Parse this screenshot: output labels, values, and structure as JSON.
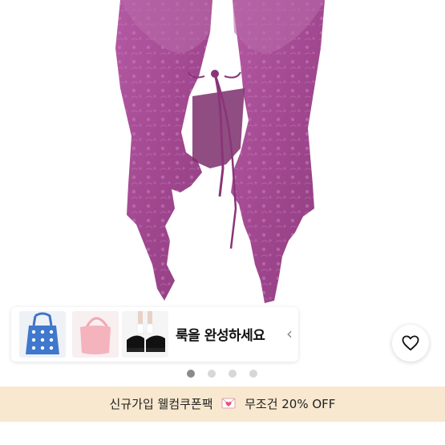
{
  "product": {
    "image_name": "pink-lace-ruffle-tie-top"
  },
  "complete_look": {
    "title": "룩을 완성하세요",
    "chevron": "‹",
    "thumbnails": [
      {
        "name": "blue-heart-knit-bag"
      },
      {
        "name": "pink-shoulder-bag"
      },
      {
        "name": "black-mary-jane-shoes"
      }
    ]
  },
  "like_button": {
    "icon": "heart-outline-icon"
  },
  "carousel": {
    "total": 4,
    "active": 0
  },
  "promo": {
    "text_before": "신규가입 웰컴쿠폰팩",
    "emoji": "heart-letter-icon",
    "text_after": "무조건 20% OFF"
  },
  "colors": {
    "fabric": "#a54a93",
    "promo_bg": "#f8e8cf",
    "dot_active": "#8a8a8a",
    "dot_inactive": "#d7d7d7"
  }
}
